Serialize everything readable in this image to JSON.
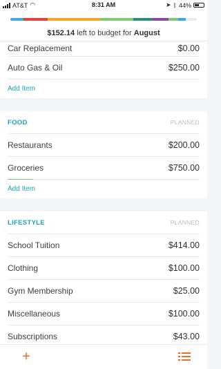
{
  "status": {
    "carrier": "AT&T",
    "time": "8:31 AM",
    "battery": "44%"
  },
  "header": {
    "amount": "$152.14",
    "text_mid": " left to budget for ",
    "month": "August",
    "progress_segments": [
      {
        "color": "#3fa9dd",
        "fraction": 0.07
      },
      {
        "color": "#e0443a",
        "fraction": 0.13
      },
      {
        "color": "#f4a62a",
        "fraction": 0.28
      },
      {
        "color": "#7cc96f",
        "fraction": 0.18
      },
      {
        "color": "#2f8c7a",
        "fraction": 0.1
      },
      {
        "color": "#8a4aa0",
        "fraction": 0.09
      },
      {
        "color": "#7cc96f",
        "fraction": 0.05
      },
      {
        "color": "#3fa9dd",
        "fraction": 0.04
      },
      {
        "color": "#e9ebed",
        "fraction": 0.06
      }
    ]
  },
  "transportation": {
    "items": [
      {
        "label": "Car Replacement",
        "amount": "$0.00"
      },
      {
        "label": "Auto Gas & Oil",
        "amount": "$250.00"
      }
    ],
    "add_label": "Add Item"
  },
  "food": {
    "title": "FOOD",
    "planned": "PLANNED",
    "items": [
      {
        "label": "Restaurants",
        "amount": "$200.00"
      },
      {
        "label": "Groceries",
        "amount": "$750.00"
      }
    ],
    "add_label": "Add Item"
  },
  "lifestyle": {
    "title": "LIFESTYLE",
    "planned": "PLANNED",
    "items": [
      {
        "label": "School Tuition",
        "amount": "$414.00"
      },
      {
        "label": "Clothing",
        "amount": "$100.00"
      },
      {
        "label": "Gym Membership",
        "amount": "$25.00"
      },
      {
        "label": "Miscellaneous",
        "amount": "$100.00"
      },
      {
        "label": "Subscriptions",
        "amount": "$43.00"
      }
    ]
  },
  "tabbar": {
    "add_icon": "plus-icon",
    "list_icon": "list-icon",
    "accent": "#f06b24"
  }
}
